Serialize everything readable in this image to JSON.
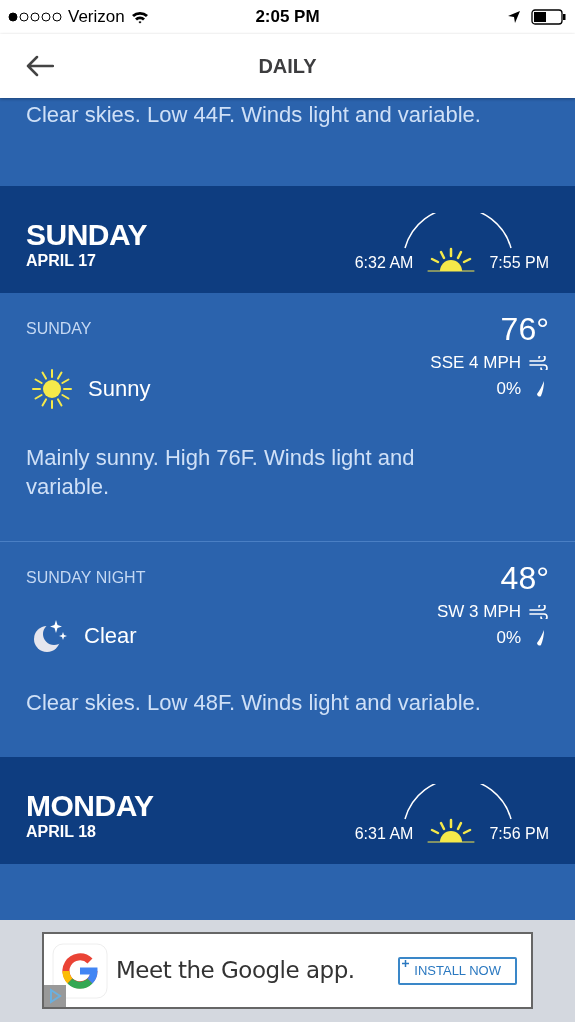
{
  "status_bar": {
    "carrier": "Verizon",
    "time": "2:05 PM"
  },
  "header": {
    "title": "DAILY"
  },
  "previous_text": "Clear skies. Low 44F. Winds light and variable.",
  "days": [
    {
      "name": "SUNDAY",
      "date": "APRIL 17",
      "sunrise": "6:32 AM",
      "sunset": "7:55 PM",
      "periods": [
        {
          "label": "SUNDAY",
          "temp": "76°",
          "wind": "SSE 4 MPH",
          "precip": "0%",
          "condition": "Sunny",
          "kind": "sun",
          "description": "Mainly sunny. High 76F. Winds light and variable."
        },
        {
          "label": "SUNDAY NIGHT",
          "temp": "48°",
          "wind": "SW 3 MPH",
          "precip": "0%",
          "condition": "Clear",
          "kind": "moon",
          "description": "Clear skies. Low 48F. Winds light and variable."
        }
      ]
    },
    {
      "name": "MONDAY",
      "date": "APRIL 18",
      "sunrise": "6:31 AM",
      "sunset": "7:56 PM"
    }
  ],
  "ad": {
    "text": "Meet the Google app.",
    "button": "INSTALL NOW"
  }
}
